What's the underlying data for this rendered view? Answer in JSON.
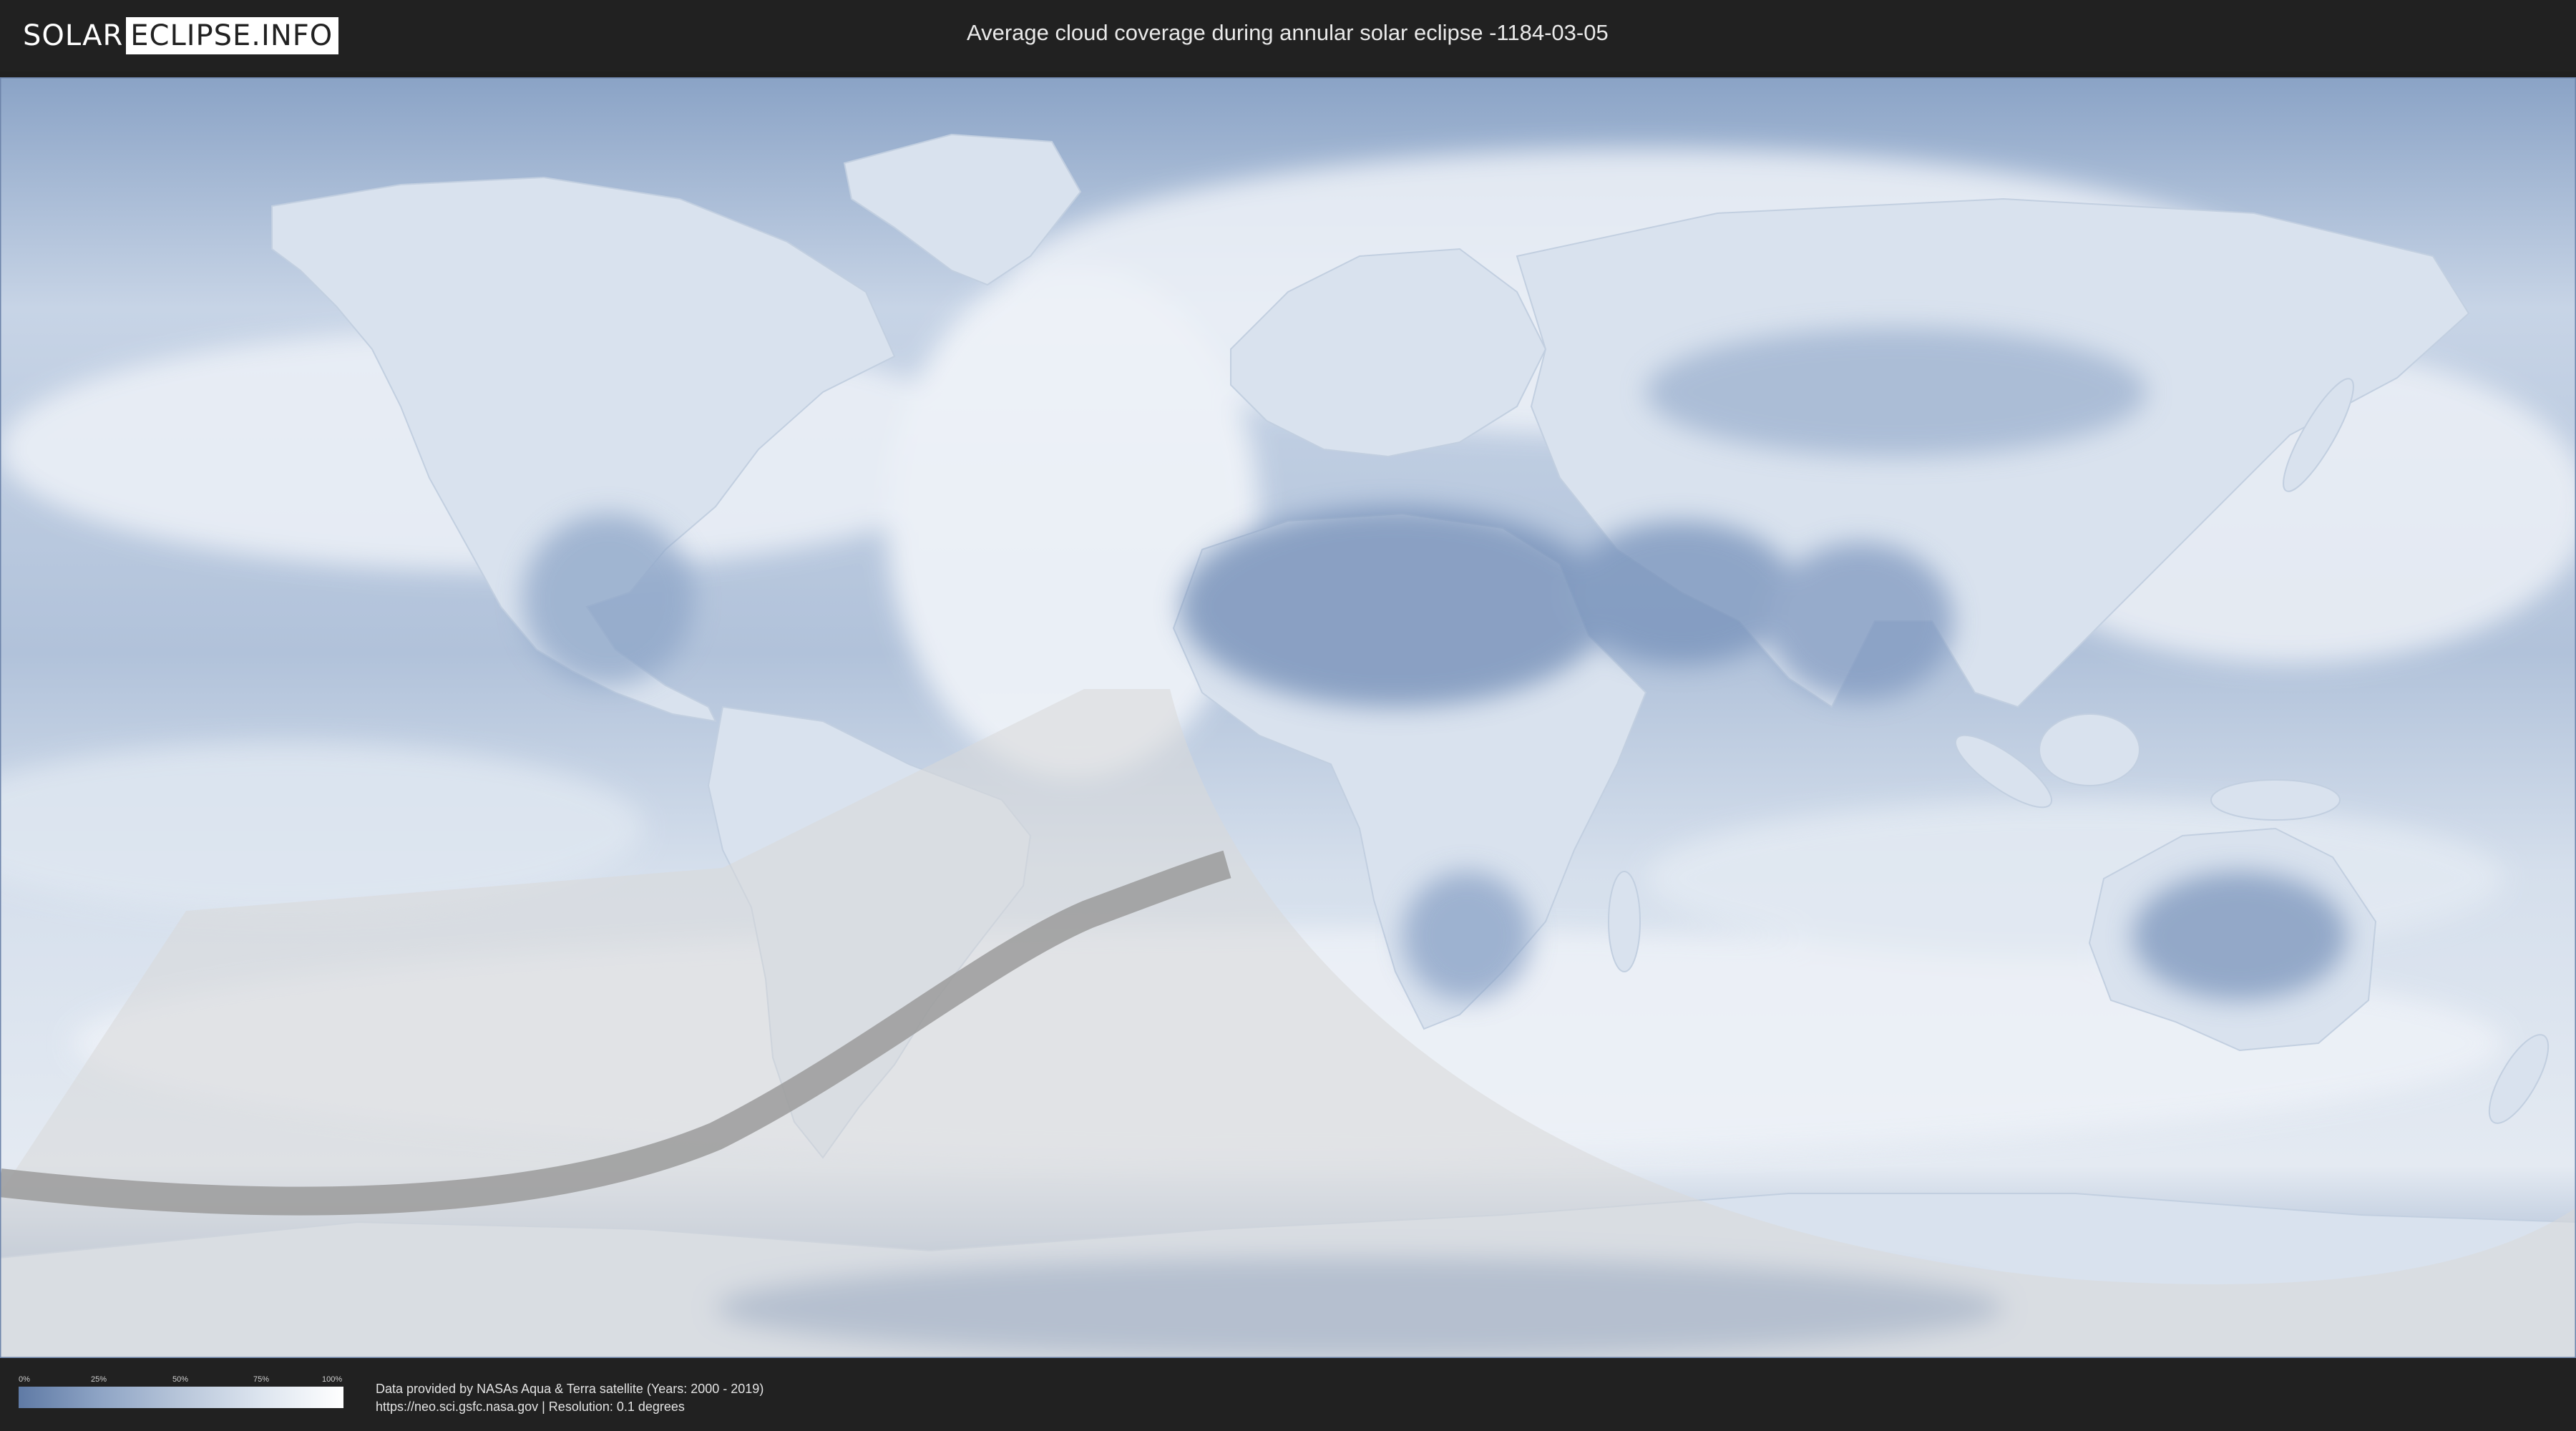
{
  "header": {
    "logo_left": "SOLAR",
    "logo_right": "ECLIPSE.INFO",
    "title": "Average cloud coverage during annular solar eclipse -1184-03-05"
  },
  "map": {
    "ocean_color": "#aebfd6",
    "land_color": "#7f98bd",
    "cloud_color": "#f3f6fa",
    "eclipse_region_color": "#d7d7d7",
    "annular_path_color": "#9b9b9b"
  },
  "legend": {
    "ticks": [
      "0%",
      "25%",
      "50%",
      "75%",
      "100%"
    ],
    "gradient_from": "#5f7aa5",
    "gradient_to": "#ffffff"
  },
  "footer": {
    "line1": "Data provided by NASAs Aqua & Terra satellite (Years: 2000 - 2019)",
    "line2": "https://neo.sci.gsfc.nasa.gov | Resolution: 0.1 degrees"
  }
}
